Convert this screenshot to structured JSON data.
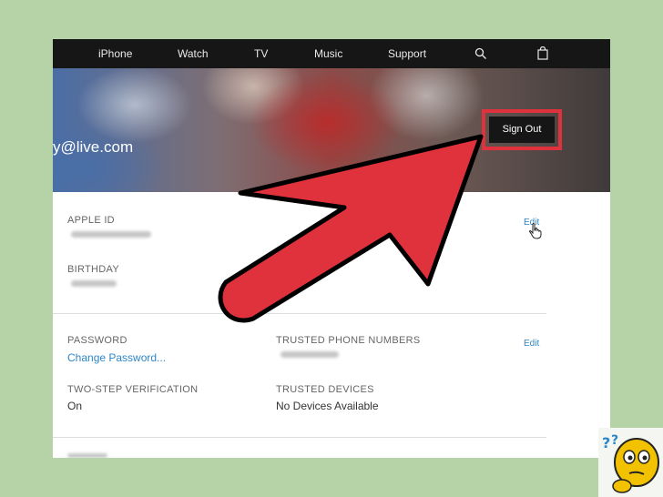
{
  "nav": {
    "items": [
      "iPhone",
      "Watch",
      "TV",
      "Music",
      "Support"
    ],
    "search_icon": "search-icon",
    "bag_icon": "shopping-bag-icon"
  },
  "header": {
    "email": "y@live.com",
    "sign_out": "Sign Out"
  },
  "account": {
    "apple_id_label": "APPLE ID",
    "birthday_label": "BIRTHDAY",
    "edit1": "Edit",
    "password_label": "PASSWORD",
    "change_password": "Change Password...",
    "trusted_phone_label": "TRUSTED PHONE NUMBERS",
    "edit2": "Edit",
    "two_step_label": "TWO-STEP VERIFICATION",
    "two_step_value": "On",
    "trusted_devices_label": "TRUSTED DEVICES",
    "trusted_devices_value": "No Devices Available"
  },
  "colors": {
    "highlight": "#e0323c",
    "link": "#2f86c7",
    "nav_bg": "#161616",
    "page_bg": "#b6d3a8"
  }
}
